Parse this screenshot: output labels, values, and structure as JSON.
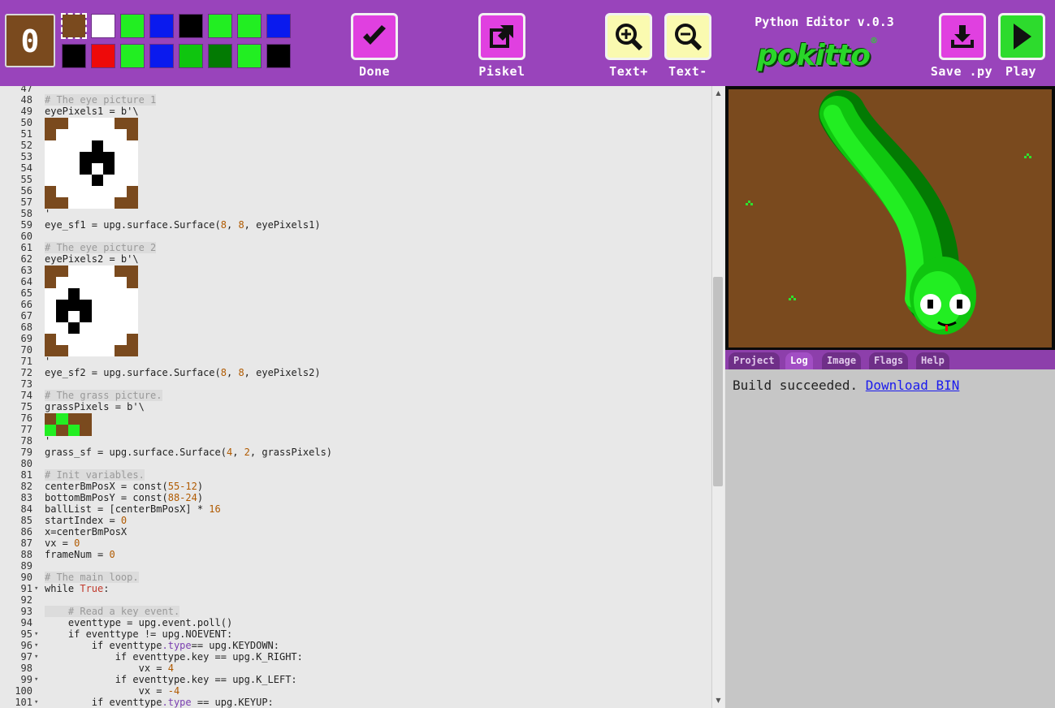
{
  "palette": {
    "current_color": "#7a4a1e",
    "current_index": "0",
    "top_row": [
      "#7a4a1e",
      "#ffffff",
      "#22ee22",
      "#0a1aee",
      "#000000",
      "#22ee22",
      "#22ee22",
      "#0a1aee"
    ],
    "bottom_row": [
      "#000000",
      "#ee0a0a",
      "#22ee22",
      "#0a1aee",
      "#0fc50f",
      "#037a03",
      "#22ee22",
      "#000000"
    ]
  },
  "toolbar": {
    "done_label": "Done",
    "piskel_label": "Piskel",
    "text_plus_label": "Text+",
    "text_minus_label": "Text-",
    "editor_title": "Python Editor v.0.3",
    "logo_text": "pokitto",
    "logo_mark": "®",
    "save_label": "Save .py",
    "play_label": "Play",
    "colors": {
      "magenta": "#e040e0",
      "pale_yellow": "#fafab0",
      "green": "#2ddb2d",
      "toolbar": "#9944bb"
    }
  },
  "code": {
    "lines": [
      {
        "n": "47",
        "t": ""
      },
      {
        "n": "48",
        "t": "# The eye picture 1",
        "c": true
      },
      {
        "n": "49",
        "t": "eyePixels1 = b'\\"
      },
      {
        "n": "50",
        "t": ""
      },
      {
        "n": "51",
        "t": ""
      },
      {
        "n": "52",
        "t": ""
      },
      {
        "n": "53",
        "t": ""
      },
      {
        "n": "54",
        "t": ""
      },
      {
        "n": "55",
        "t": ""
      },
      {
        "n": "56",
        "t": ""
      },
      {
        "n": "57",
        "t": ""
      },
      {
        "n": "58",
        "t": "'"
      },
      {
        "n": "59",
        "t": "eye_sf1 = upg.surface.Surface(8, 8, eyePixels1)"
      },
      {
        "n": "60",
        "t": ""
      },
      {
        "n": "61",
        "t": "# The eye picture 2",
        "c": true
      },
      {
        "n": "62",
        "t": "eyePixels2 = b'\\"
      },
      {
        "n": "63",
        "t": ""
      },
      {
        "n": "64",
        "t": ""
      },
      {
        "n": "65",
        "t": ""
      },
      {
        "n": "66",
        "t": ""
      },
      {
        "n": "67",
        "t": ""
      },
      {
        "n": "68",
        "t": ""
      },
      {
        "n": "69",
        "t": ""
      },
      {
        "n": "70",
        "t": ""
      },
      {
        "n": "71",
        "t": "'"
      },
      {
        "n": "72",
        "t": "eye_sf2 = upg.surface.Surface(8, 8, eyePixels2)"
      },
      {
        "n": "73",
        "t": ""
      },
      {
        "n": "74",
        "t": "# The grass picture.",
        "c": true
      },
      {
        "n": "75",
        "t": "grassPixels = b'\\"
      },
      {
        "n": "76",
        "t": ""
      },
      {
        "n": "77",
        "t": ""
      },
      {
        "n": "78",
        "t": "'"
      },
      {
        "n": "79",
        "t": "grass_sf = upg.surface.Surface(4, 2, grassPixels)"
      },
      {
        "n": "80",
        "t": ""
      },
      {
        "n": "81",
        "t": "# Init variables.",
        "c": true
      },
      {
        "n": "82",
        "t": "centerBmPosX = const(55-12)"
      },
      {
        "n": "83",
        "t": "bottomBmPosY = const(88-24)"
      },
      {
        "n": "84",
        "t": "ballList = [centerBmPosX] * 16"
      },
      {
        "n": "85",
        "t": "startIndex = 0"
      },
      {
        "n": "86",
        "t": "x=centerBmPosX"
      },
      {
        "n": "87",
        "t": "vx = 0"
      },
      {
        "n": "88",
        "t": "frameNum = 0"
      },
      {
        "n": "89",
        "t": ""
      },
      {
        "n": "90",
        "t": "# The main loop.",
        "c": true
      },
      {
        "n": "91",
        "t": "while True:",
        "f": true
      },
      {
        "n": "92",
        "t": ""
      },
      {
        "n": "93",
        "t": "    # Read a key event.",
        "c": true
      },
      {
        "n": "94",
        "t": "    eventtype = upg.event.poll()"
      },
      {
        "n": "95",
        "t": "    if eventtype != upg.NOEVENT:",
        "f": true
      },
      {
        "n": "96",
        "t": "        if eventtype.type== upg.KEYDOWN:",
        "f": true
      },
      {
        "n": "97",
        "t": "            if eventtype.key == upg.K_RIGHT:",
        "f": true
      },
      {
        "n": "98",
        "t": "                vx = 4"
      },
      {
        "n": "99",
        "t": "            if eventtype.key == upg.K_LEFT:",
        "f": true
      },
      {
        "n": "100",
        "t": "                vx = -4"
      },
      {
        "n": "101",
        "t": "        if eventtype.type == upg.KEYUP:",
        "f": true
      }
    ]
  },
  "log": {
    "tabs": [
      "Project",
      "Log",
      "Image",
      "Flags",
      "Help"
    ],
    "active_tab": "Log",
    "message": "Build succeeded. ",
    "link": "Download BIN"
  }
}
